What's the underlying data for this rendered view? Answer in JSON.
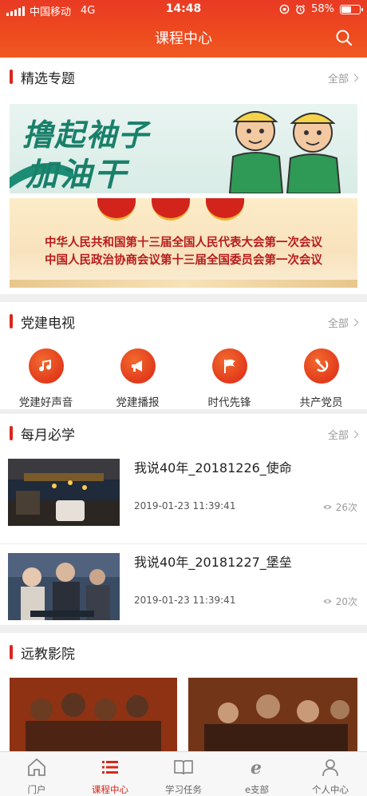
{
  "status_bar": {
    "carrier": "中国移动",
    "network": "4G",
    "time": "14:48",
    "battery": "58%",
    "battery_level": 0.58
  },
  "header": {
    "title": "课程中心",
    "search_icon": "search-icon"
  },
  "featured": {
    "title": "精选专题",
    "more": "全部",
    "banners": [
      {
        "line1": "撸起袖子",
        "line2": "加油干"
      },
      {
        "line1": "中华人民共和国第十三届全国人民代表大会第一次会议",
        "line2": "中国人民政治协商会议第十三届全国委员会第一次会议"
      }
    ]
  },
  "party_tv": {
    "title": "党建电视",
    "more": "全部",
    "items": [
      {
        "label": "党建好声音",
        "icon": "music-note-icon"
      },
      {
        "label": "党建播报",
        "icon": "megaphone-icon"
      },
      {
        "label": "时代先锋",
        "icon": "flag-icon"
      },
      {
        "label": "共产党员",
        "icon": "hammer-sickle-icon"
      }
    ]
  },
  "monthly": {
    "title": "每月必学",
    "more": "全部",
    "videos": [
      {
        "title": "我说40年_20181226_使命",
        "date": "2019-01-23 11:39:41",
        "views": "26次"
      },
      {
        "title": "我说40年_20181227_堡垒",
        "date": "2019-01-23 11:39:41",
        "views": "20次"
      }
    ]
  },
  "cinema": {
    "title": "远教影院"
  },
  "tabbar": {
    "tabs": [
      {
        "label": "门户",
        "icon": "home-icon"
      },
      {
        "label": "课程中心",
        "icon": "list-icon",
        "active": true
      },
      {
        "label": "学习任务",
        "icon": "book-icon"
      },
      {
        "label": "e支部",
        "icon": "e-icon"
      },
      {
        "label": "个人中心",
        "icon": "person-icon"
      }
    ]
  },
  "colors": {
    "accent": "#d9261c",
    "header": "#ee4b1f"
  }
}
